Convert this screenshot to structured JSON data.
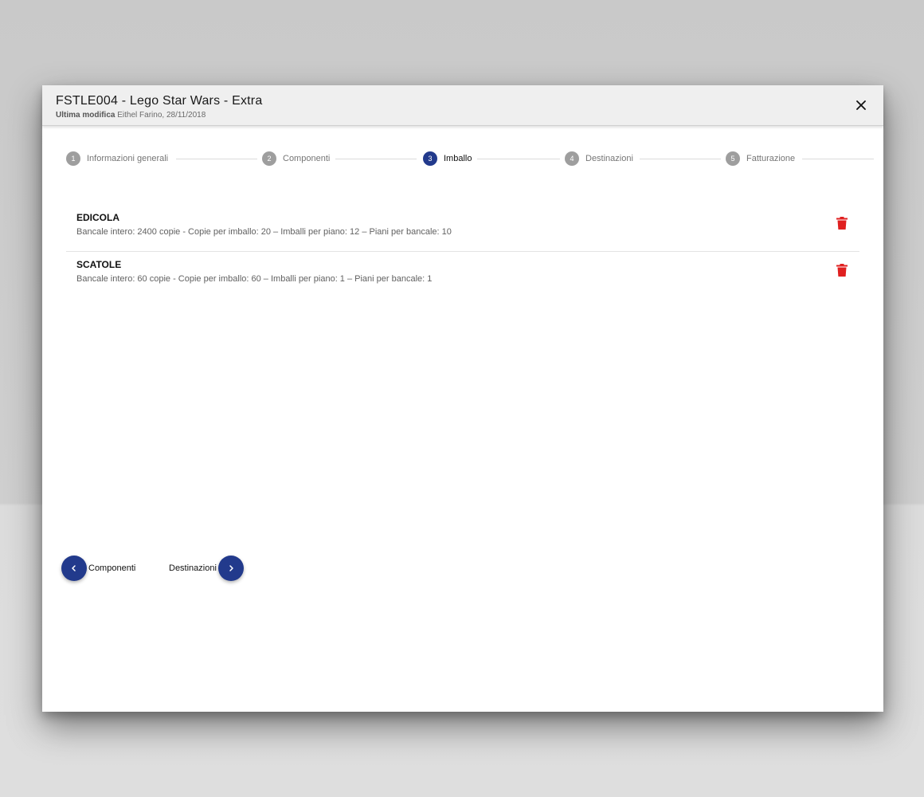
{
  "dialog": {
    "title": "FSTLE004 - Lego Star Wars - Extra",
    "subtitle_label": "Ultima modifica",
    "subtitle_value": "Eithel Farino, 28/11/2018",
    "close_icon": "close-icon"
  },
  "stepper": {
    "steps": [
      {
        "number": "1",
        "label": "Informazioni generali",
        "state": "inactive"
      },
      {
        "number": "2",
        "label": "Componenti",
        "state": "inactive"
      },
      {
        "number": "3",
        "label": "Imballo",
        "state": "active"
      },
      {
        "number": "4",
        "label": "Destinazioni",
        "state": "inactive"
      },
      {
        "number": "5",
        "label": "Fatturazione",
        "state": "inactive"
      }
    ]
  },
  "packages": [
    {
      "name": "EDICOLA",
      "details": "Bancale intero: 2400 copie - Copie per imballo: 20 – Imballi per piano: 12 – Piani per bancale: 10",
      "delete_icon": "trash-icon"
    },
    {
      "name": "SCATOLE",
      "details": "Bancale intero: 60 copie - Copie per imballo: 60 – Imballi per piano: 1 – Piani per bancale: 1",
      "delete_icon": "trash-icon"
    }
  ],
  "navigation": {
    "prev_label": "Componenti",
    "next_label": "Destinazioni"
  },
  "colors": {
    "accent": "#223a8c",
    "inactive_step": "#9e9e9e",
    "delete": "#e02020",
    "header_bg": "#efefef"
  }
}
